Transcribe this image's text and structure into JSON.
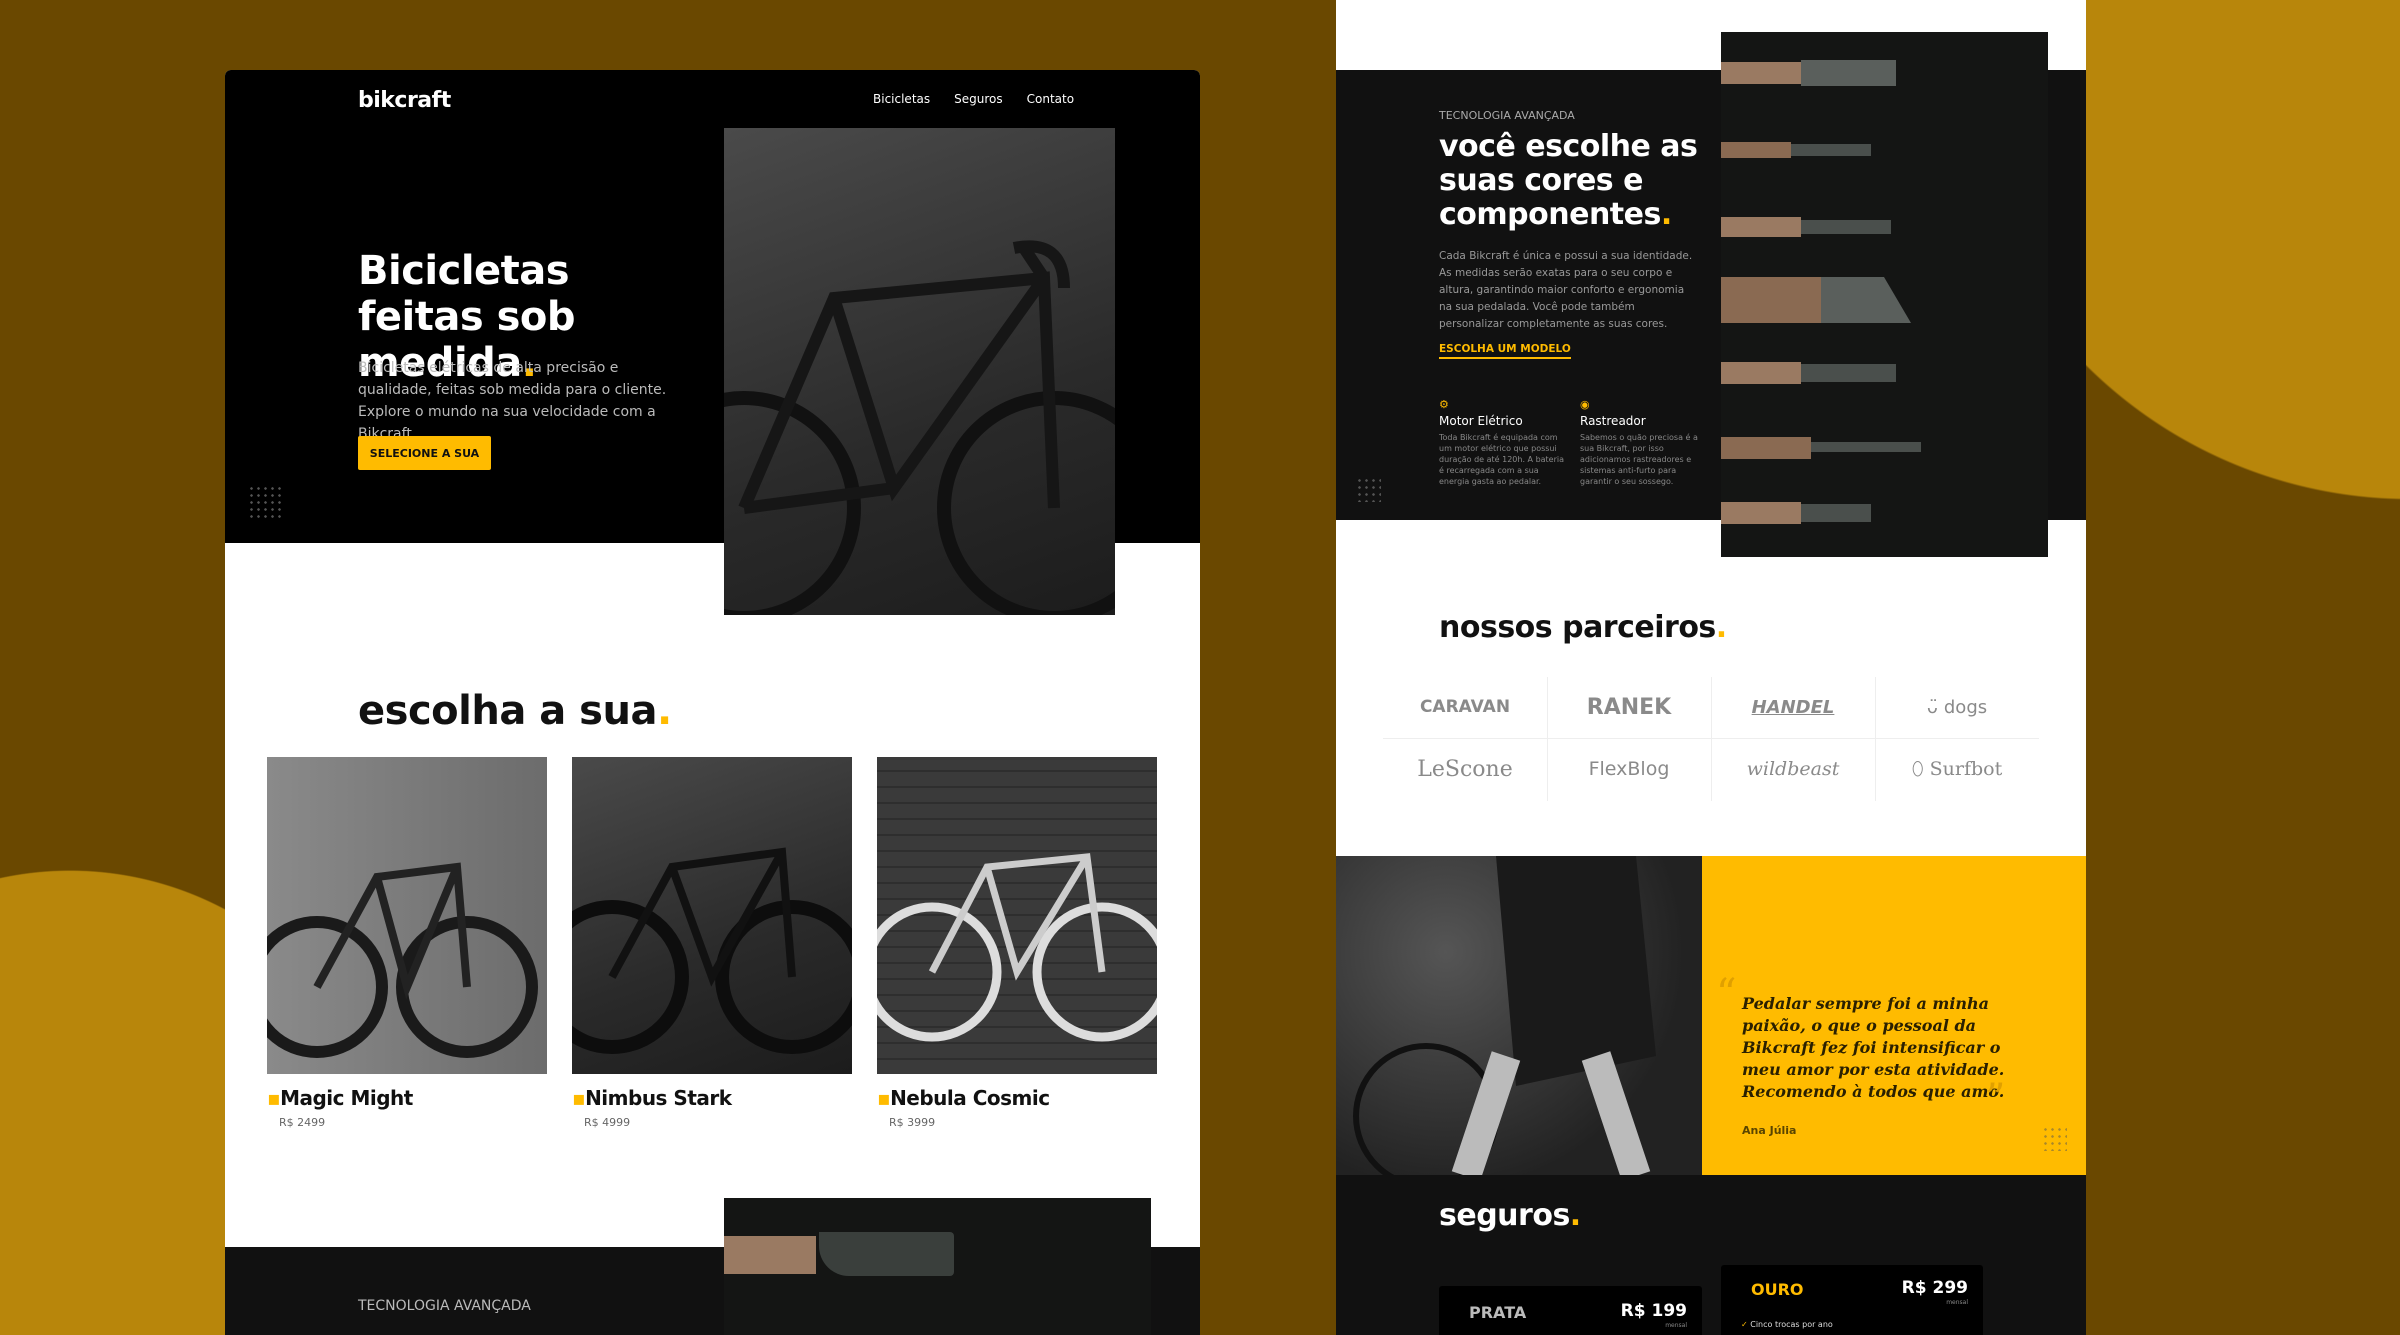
{
  "colors": {
    "accent": "#ffbb00",
    "dark": "#111111",
    "background": "#6a4800",
    "circle": "#b8860b"
  },
  "left": {
    "header": {
      "logo": "bikcraft",
      "nav": [
        "Bicicletas",
        "Seguros",
        "Contato"
      ]
    },
    "hero": {
      "title": "Bicicletas feitas sob medida",
      "dot": ".",
      "text": "Bicicletas elétricas de alta precisão e qualidade, feitas sob medida para o cliente. Explore o mundo na sua velocidade com a Bikcraft.",
      "button": "SELECIONE A SUA"
    },
    "products": {
      "title": "escolha a sua",
      "dot": ".",
      "items": [
        {
          "name": "Magic Might",
          "price": "R$ 2499"
        },
        {
          "name": "Nimbus Stark",
          "price": "R$ 4999"
        },
        {
          "name": "Nebula Cosmic",
          "price": "R$ 3999"
        }
      ]
    },
    "tech": {
      "label": "TECNOLOGIA AVANÇADA"
    }
  },
  "right": {
    "tech": {
      "label": "TECNOLOGIA AVANÇADA",
      "title": "você escolhe as suas cores e componentes",
      "dot": ".",
      "text": "Cada Bikcraft é única e possui a sua identidade. As medidas serão exatas para o seu corpo e altura, garantindo maior conforto e ergonomia na sua pedalada. Você pode também personalizar completamente as suas cores.",
      "link": "ESCOLHA UM MODELO",
      "features": [
        {
          "icon": "bike-icon",
          "title": "Motor Elétrico",
          "text": "Toda Bikcraft é equipada com um motor elétrico que possui duração de até 120h. A bateria é recarregada com a sua energia gasta ao pedalar."
        },
        {
          "icon": "target-icon",
          "title": "Rastreador",
          "text": "Sabemos o quão preciosa é a sua Bikcraft, por isso adicionamos rastreadores e sistemas anti-furto para garantir o seu sossego."
        }
      ]
    },
    "partners": {
      "title": "nossos parceiros",
      "dot": ".",
      "logos": [
        "CARAVAN",
        "RANEK",
        "HANDEL",
        "dogs",
        "LeScone",
        "FlexBlog",
        "wildbeast",
        "Surfbot"
      ]
    },
    "testimonial": {
      "quote": "Pedalar sempre foi a minha paixão, o que o pessoal da Bikcraft fez foi intensificar o meu amor por esta atividade. Recomendo à todos que amo.",
      "author": "Ana Júlia"
    },
    "insurance": {
      "title": "seguros",
      "dot": ".",
      "plans": [
        {
          "name": "PRATA",
          "price": "R$ 199",
          "period": "mensal"
        },
        {
          "name": "OURO",
          "price": "R$ 299",
          "period": "mensal",
          "features": [
            "Cinco trocas por ano"
          ]
        }
      ]
    }
  }
}
